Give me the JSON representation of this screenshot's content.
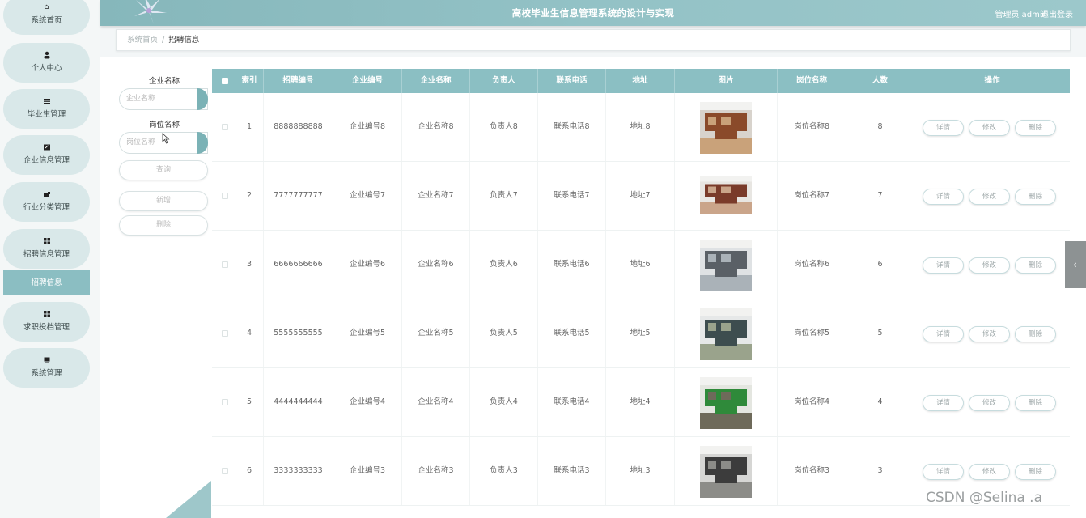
{
  "header": {
    "title": "高校毕业生信息管理系统的设计与实现",
    "user": "管理员 admin",
    "logout": "退出登录"
  },
  "sidebar": {
    "items": [
      {
        "label": "系统首页",
        "icon": "home-icon"
      },
      {
        "label": "个人中心",
        "icon": "user-icon"
      },
      {
        "label": "毕业生管理",
        "icon": "list-icon"
      },
      {
        "label": "企业信息管理",
        "icon": "edit-icon"
      },
      {
        "label": "行业分类管理",
        "icon": "tag-icon"
      },
      {
        "label": "招聘信息管理",
        "icon": "grid-icon"
      },
      {
        "label": "求职投档管理",
        "icon": "grid-icon"
      },
      {
        "label": "系统管理",
        "icon": "monitor-icon"
      }
    ],
    "active_sub": "招聘信息"
  },
  "breadcrumb": {
    "home": "系统首页",
    "sep": "/",
    "current": "招聘信息"
  },
  "search": {
    "company_label": "企业名称",
    "company_placeholder": "企业名称",
    "position_label": "岗位名称",
    "position_placeholder": "岗位名称",
    "query": "查询",
    "add": "新增",
    "delete": "删除"
  },
  "table": {
    "columns": [
      "索引",
      "招聘编号",
      "企业编号",
      "企业名称",
      "负责人",
      "联系电话",
      "地址",
      "图片",
      "岗位名称",
      "人数",
      "操作"
    ],
    "rows": [
      {
        "index": "1",
        "code": "8888888888",
        "company_no": "企业编号8",
        "company": "企业名称8",
        "manager": "负责人8",
        "phone": "联系电话8",
        "address": "地址8",
        "position": "岗位名称8",
        "count": "8"
      },
      {
        "index": "2",
        "code": "7777777777",
        "company_no": "企业编号7",
        "company": "企业名称7",
        "manager": "负责人7",
        "phone": "联系电话7",
        "address": "地址7",
        "position": "岗位名称7",
        "count": "7"
      },
      {
        "index": "3",
        "code": "6666666666",
        "company_no": "企业编号6",
        "company": "企业名称6",
        "manager": "负责人6",
        "phone": "联系电话6",
        "address": "地址6",
        "position": "岗位名称6",
        "count": "6"
      },
      {
        "index": "4",
        "code": "5555555555",
        "company_no": "企业编号5",
        "company": "企业名称5",
        "manager": "负责人5",
        "phone": "联系电话5",
        "address": "地址5",
        "position": "岗位名称5",
        "count": "5"
      },
      {
        "index": "5",
        "code": "4444444444",
        "company_no": "企业编号4",
        "company": "企业名称4",
        "manager": "负责人4",
        "phone": "联系电话4",
        "address": "地址4",
        "position": "岗位名称4",
        "count": "4"
      },
      {
        "index": "6",
        "code": "3333333333",
        "company_no": "企业编号3",
        "company": "企业名称3",
        "manager": "负责人3",
        "phone": "联系电话3",
        "address": "地址3",
        "position": "岗位名称3",
        "count": "3"
      }
    ],
    "actions": {
      "detail": "详情",
      "edit": "修改",
      "delete": "删除"
    }
  },
  "watermark": "CSDN @Selina .a",
  "colors": {
    "accent": "#8bbfc3",
    "sidebar_active": "#8bbec2",
    "header": "#93c2c6"
  }
}
